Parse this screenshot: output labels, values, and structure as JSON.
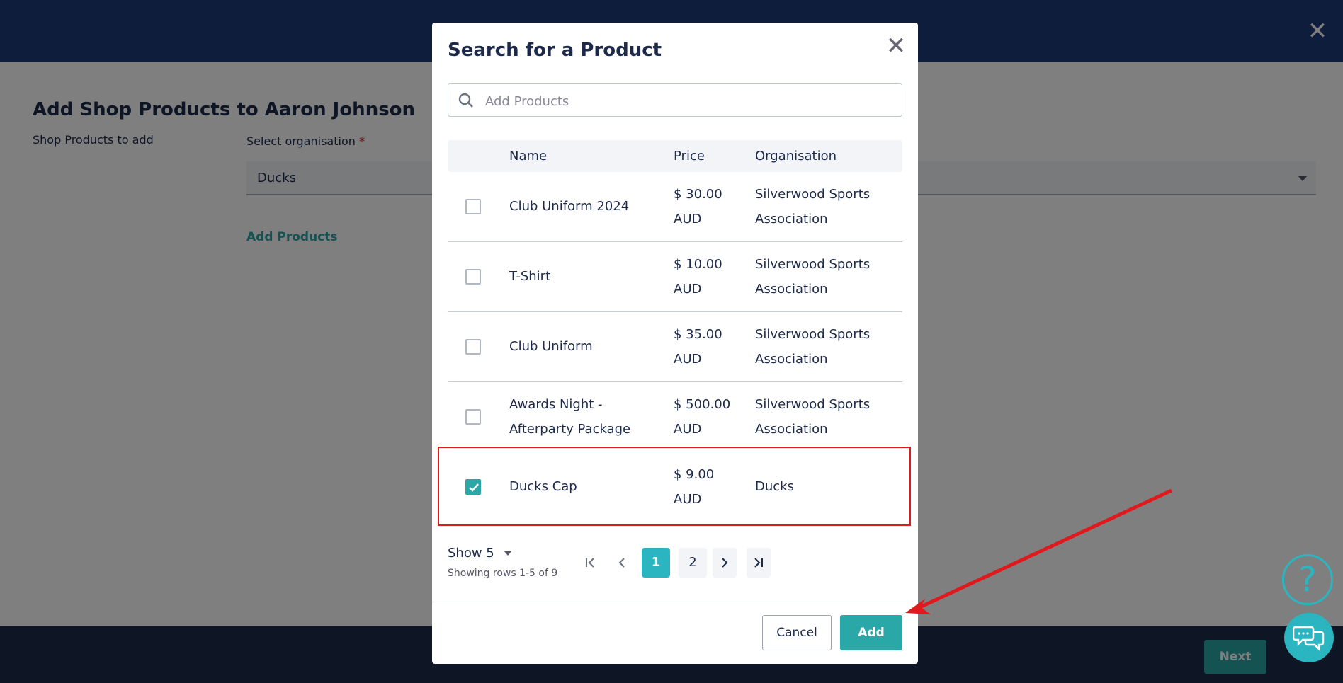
{
  "page": {
    "title": "Add Shop Products to Aaron Johnson",
    "side_label": "Shop Products to add",
    "org_label": "Select organisation",
    "required_mark": "*",
    "org_value": "Ducks",
    "add_products_link": "Add Products",
    "next_label": "Next"
  },
  "modal": {
    "title": "Search for a Product",
    "search_placeholder": "Add Products",
    "columns": {
      "name": "Name",
      "price": "Price",
      "organisation": "Organisation"
    },
    "rows": [
      {
        "name": "Club Uniform 2024",
        "price": "$ 30.00 AUD",
        "organisation": "Silverwood Sports Association",
        "checked": false
      },
      {
        "name": "T-Shirt",
        "price": "$ 10.00 AUD",
        "organisation": "Silverwood Sports Association",
        "checked": false
      },
      {
        "name": "Club Uniform",
        "price": "$ 35.00 AUD",
        "organisation": "Silverwood Sports Association",
        "checked": false
      },
      {
        "name": "Awards Night - Afterparty Package",
        "price": "$ 500.00 AUD",
        "organisation": "Silverwood Sports Association",
        "checked": false
      },
      {
        "name": "Ducks Cap",
        "price": "$ 9.00 AUD",
        "organisation": "Ducks",
        "checked": true
      }
    ],
    "show_label": "Show 5",
    "rows_info": "Showing rows 1-5 of 9",
    "pages": [
      "1",
      "2"
    ],
    "current_page": "1",
    "cancel_label": "Cancel",
    "add_label": "Add"
  },
  "widgets": {
    "help_symbol": "?"
  },
  "colors": {
    "header": "#1e3a7a",
    "accent": "#2aa7a7",
    "annotation": "#e0191c"
  }
}
